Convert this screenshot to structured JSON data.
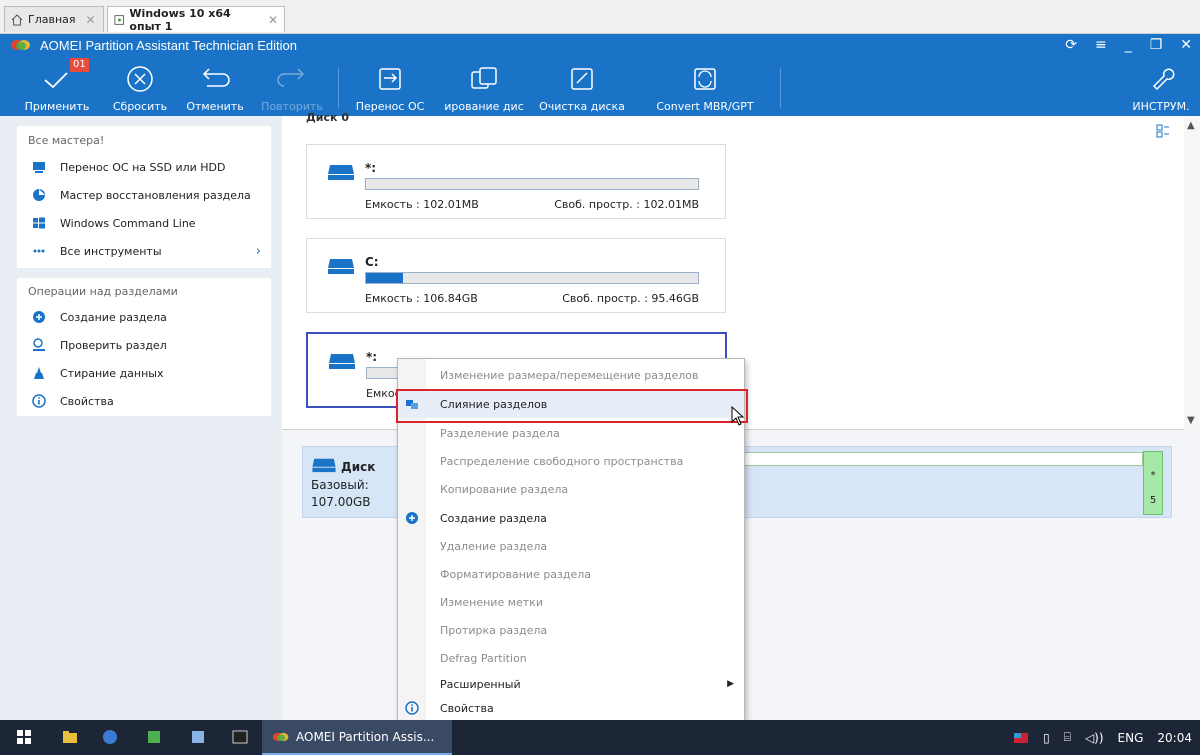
{
  "vm_tabs": [
    {
      "label": "Главная"
    },
    {
      "label": "Windows 10 x64 опыт 1"
    }
  ],
  "app": {
    "title": "AOMEI Partition Assistant Technician Edition",
    "accent_color": "#1a73c6"
  },
  "toolbar": {
    "badge": "01",
    "apply": "Применить",
    "reset": "Сбросить",
    "undo": "Отменить",
    "redo": "Повторить",
    "migrate_os": "Перенос ОС",
    "clone_disk": "ирование дис",
    "wipe_disk": "Очистка диска",
    "convert": "Convert MBR/GPT",
    "tools": "ИНСТРУМ."
  },
  "left": {
    "wizards_title": "Все мастера!",
    "wizards": [
      {
        "label": "Перенос ОС на SSD или HDD",
        "icon": "migrate-icon"
      },
      {
        "label": "Мастер восстановления раздела",
        "icon": "recovery-icon"
      },
      {
        "label": "Windows Command Line",
        "icon": "windows-icon"
      },
      {
        "label": "Все инструменты",
        "icon": "more-icon"
      }
    ],
    "ops_title": "Операции над разделами",
    "ops": [
      {
        "label": "Создание раздела",
        "icon": "create-partition-icon"
      },
      {
        "label": "Проверить раздел",
        "icon": "check-partition-icon"
      },
      {
        "label": "Стирание данных",
        "icon": "wipe-icon"
      },
      {
        "label": "Свойства",
        "icon": "info-icon"
      }
    ]
  },
  "main": {
    "header_cut": "Диск 0",
    "partitions": [
      {
        "name": "*:",
        "capacity": "Емкость : 102.01MB",
        "free": "Своб. простр. : 102.01MB",
        "used_fraction": 0.0
      },
      {
        "name": "C:",
        "capacity": "Емкость : 106.84GB",
        "free": "Своб. простр. : 95.46GB",
        "used_fraction": 0.11
      },
      {
        "name": "*:",
        "capacity": "Емкость",
        "free": "",
        "used_fraction": 0.0
      }
    ],
    "disk": {
      "name": "Диск",
      "type": "Базовый:",
      "size": "107.00GB",
      "green_box_top": "*",
      "green_box_bottom": "5"
    }
  },
  "context_menu": {
    "items": [
      {
        "label": "Изменение размера/перемещение разделов",
        "enabled": false
      },
      {
        "label": "Слияние разделов",
        "enabled": true,
        "highlighted": true,
        "icon": "merge-icon"
      },
      {
        "label": "Разделение раздела",
        "enabled": false
      },
      {
        "label": "Распределение свободного пространства",
        "enabled": false
      },
      {
        "label": "Копирование раздела",
        "enabled": false
      },
      {
        "label": "Создание раздела",
        "enabled": true,
        "icon": "create-partition-icon"
      },
      {
        "label": "Удаление раздела",
        "enabled": false
      },
      {
        "label": "Форматирование раздела",
        "enabled": false
      },
      {
        "label": "Изменение метки",
        "enabled": false
      },
      {
        "label": "Протирка раздела",
        "enabled": false
      },
      {
        "label": "Defrag Partition",
        "enabled": false
      },
      {
        "label": "Расширенный",
        "enabled": true,
        "submenu": true
      },
      {
        "label": "Свойства",
        "enabled": true,
        "icon": "info-icon"
      }
    ]
  },
  "taskbar": {
    "app_label": "AOMEI Partition Assis...",
    "lang": "ENG",
    "time": "20:04"
  }
}
